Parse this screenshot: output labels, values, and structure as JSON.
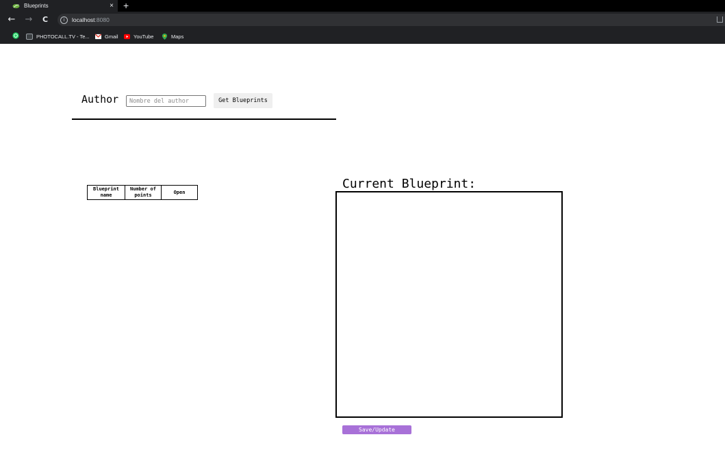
{
  "browser": {
    "tab_title": "Blueprints",
    "tab_close": "×",
    "new_tab": "+",
    "nav_back": "←",
    "nav_forward": "→",
    "nav_reload": "C",
    "info_icon": "i",
    "url_host": "localhost",
    "url_port": ":8080"
  },
  "bookmarks": [
    {
      "label": "PHOTOCALL.TV - Te...",
      "icon": "tv-icon"
    },
    {
      "label": "Gmail",
      "icon": "gmail-icon"
    },
    {
      "label": "YouTube",
      "icon": "youtube-icon"
    },
    {
      "label": "Maps",
      "icon": "maps-icon"
    }
  ],
  "search": {
    "label": "Author",
    "placeholder": "Nombre del author",
    "button_label": "Get Blueprints"
  },
  "table": {
    "headers": [
      "Blueprint name",
      "Number of points",
      "Open"
    ],
    "rows": []
  },
  "current": {
    "title": "Current Blueprint:",
    "save_label": "Save/Update"
  },
  "colors": {
    "save_button": "#a871d8",
    "chrome_bg": "#202124"
  }
}
